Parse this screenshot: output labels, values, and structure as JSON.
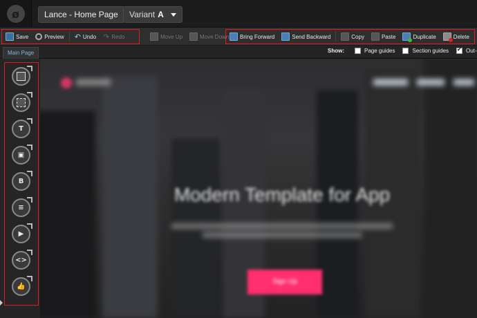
{
  "app": {
    "page_title": "Lance - Home Page",
    "variant_label": "Variant",
    "variant_letter": "A"
  },
  "toolbar": {
    "save": "Save",
    "preview": "Preview",
    "undo": "Undo",
    "redo": "Redo",
    "move_up": "Move Up",
    "move_down": "Move Down",
    "bring_forward": "Bring Forward",
    "send_backward": "Send Backward",
    "copy": "Copy",
    "paste": "Paste",
    "duplicate": "Duplicate",
    "delete": "Delete"
  },
  "tabs": {
    "main": "Main Page"
  },
  "show": {
    "label": "Show:",
    "options": [
      {
        "label": "Page guides",
        "checked": false
      },
      {
        "label": "Section guides",
        "checked": false
      },
      {
        "label": "Out-o",
        "checked": true
      }
    ]
  },
  "widgets": [
    {
      "name": "box-widget-icon",
      "glyph": ""
    },
    {
      "name": "dashed-box-widget-icon",
      "glyph": ""
    },
    {
      "name": "text-widget-icon",
      "glyph": "T"
    },
    {
      "name": "image-widget-icon",
      "glyph": "▣"
    },
    {
      "name": "button-widget-icon",
      "glyph": "B"
    },
    {
      "name": "form-widget-icon",
      "glyph": "≡"
    },
    {
      "name": "video-widget-icon",
      "glyph": "▶"
    },
    {
      "name": "code-widget-icon",
      "glyph": "<>"
    },
    {
      "name": "social-widget-icon",
      "glyph": "👍"
    }
  ],
  "canvas": {
    "hero_title": "Modern Template for App",
    "hero_cta": "Sign Up"
  },
  "colors": {
    "highlight": "#e01b24",
    "cta": "#ff2f6d",
    "tab_text": "#7fb6ec"
  }
}
